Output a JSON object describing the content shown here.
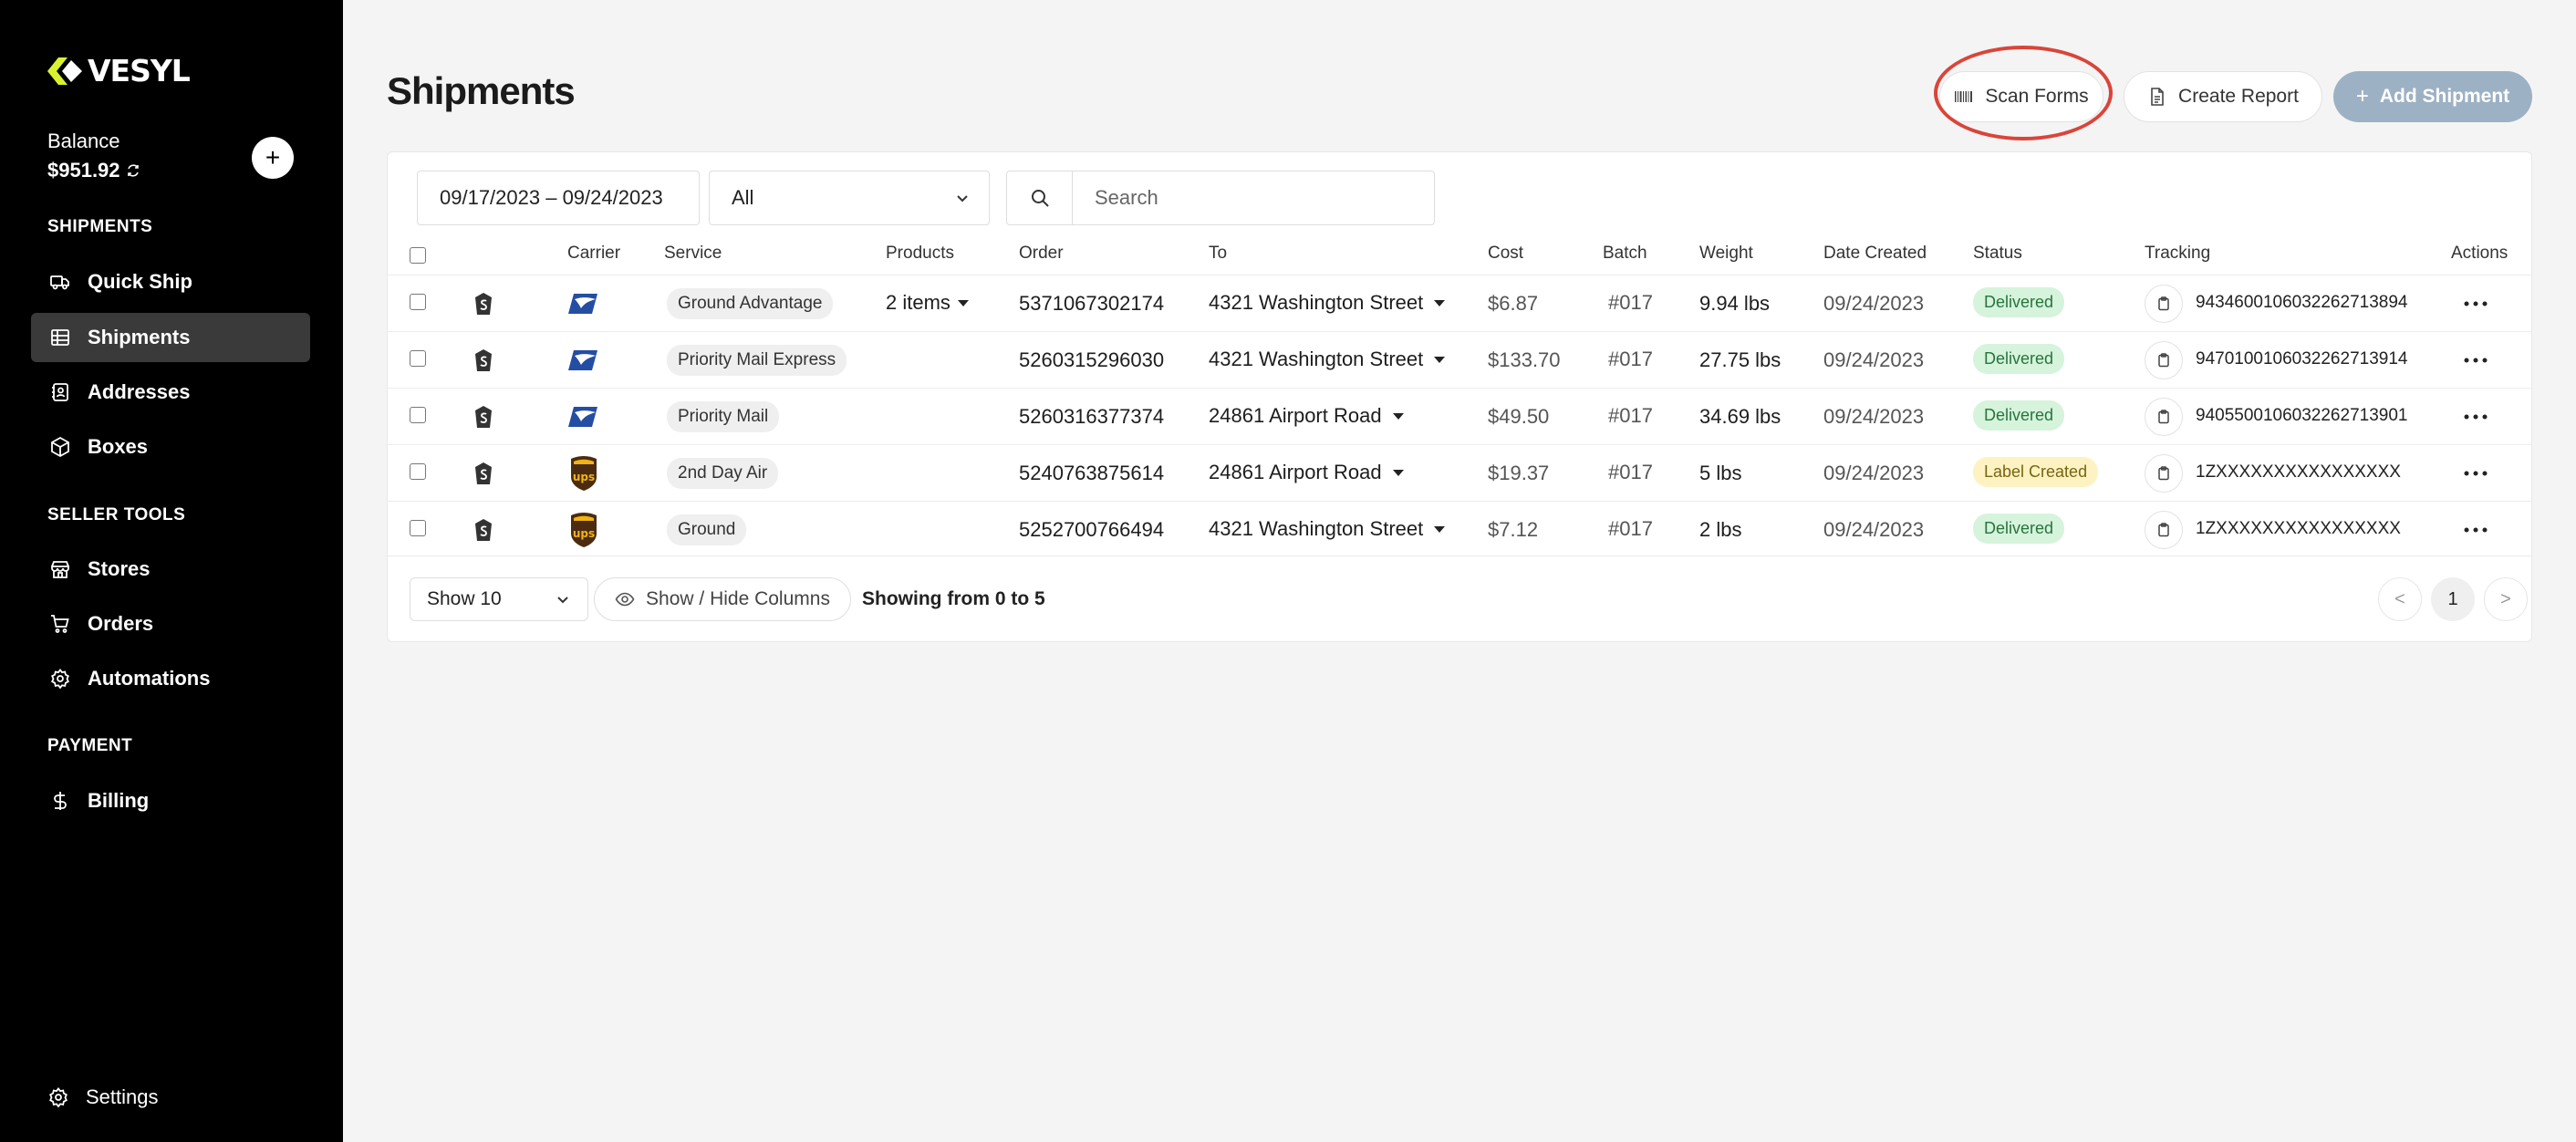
{
  "brand": {
    "name": "VESYL",
    "accent": "#d9f230"
  },
  "balance": {
    "label": "Balance",
    "amount": "$951.92"
  },
  "sidebar": {
    "sections": [
      {
        "title": "SHIPMENTS"
      },
      {
        "title": "SELLER TOOLS"
      },
      {
        "title": "PAYMENT"
      }
    ],
    "items": [
      {
        "label": "Quick Ship",
        "icon": "truck-icon"
      },
      {
        "label": "Shipments",
        "icon": "grid-icon",
        "active": true
      },
      {
        "label": "Addresses",
        "icon": "address-book-icon"
      },
      {
        "label": "Boxes",
        "icon": "box-icon"
      },
      {
        "label": "Stores",
        "icon": "store-icon"
      },
      {
        "label": "Orders",
        "icon": "cart-icon"
      },
      {
        "label": "Automations",
        "icon": "gear-icon"
      },
      {
        "label": "Billing",
        "icon": "dollar-icon"
      }
    ],
    "settings_label": "Settings"
  },
  "header": {
    "title": "Shipments",
    "scan_forms": "Scan Forms",
    "create_report": "Create Report",
    "add_shipment": "Add Shipment"
  },
  "filters": {
    "date_range": "09/17/2023 – 09/24/2023",
    "status": "All",
    "search_placeholder": "Search"
  },
  "table": {
    "columns": [
      "Carrier",
      "Service",
      "Products",
      "Order",
      "To",
      "Cost",
      "Batch",
      "Weight",
      "Date Created",
      "Status",
      "Tracking",
      "Actions"
    ],
    "rows": [
      {
        "carrier": "usps",
        "service": "Ground Advantage",
        "products": "2 items",
        "order": "5371067302174",
        "to": "4321 Washington Street",
        "cost": "$6.87",
        "batch": "#017",
        "weight": "9.94 lbs",
        "date": "09/24/2023",
        "status": "Delivered",
        "tracking": "9434600106032262713894"
      },
      {
        "carrier": "usps",
        "service": "Priority Mail Express",
        "products": "",
        "order": "5260315296030",
        "to": "4321 Washington Street",
        "cost": "$133.70",
        "batch": "#017",
        "weight": "27.75 lbs",
        "date": "09/24/2023",
        "status": "Delivered",
        "tracking": "9470100106032262713914"
      },
      {
        "carrier": "usps",
        "service": "Priority Mail",
        "products": "",
        "order": "5260316377374",
        "to": "24861 Airport Road",
        "cost": "$49.50",
        "batch": "#017",
        "weight": "34.69 lbs",
        "date": "09/24/2023",
        "status": "Delivered",
        "tracking": "9405500106032262713901"
      },
      {
        "carrier": "ups",
        "service": "2nd Day Air",
        "products": "",
        "order": "5240763875614",
        "to": "24861 Airport Road",
        "cost": "$19.37",
        "batch": "#017",
        "weight": "5 lbs",
        "date": "09/24/2023",
        "status": "Label Created",
        "tracking": "1ZXXXXXXXXXXXXXXXX"
      },
      {
        "carrier": "ups",
        "service": "Ground",
        "products": "",
        "order": "5252700766494",
        "to": "4321 Washington Street",
        "cost": "$7.12",
        "batch": "#017",
        "weight": "2 lbs",
        "date": "09/24/2023",
        "status": "Delivered",
        "tracking": "1ZXXXXXXXXXXXXXXXX"
      }
    ]
  },
  "footer": {
    "page_size": "Show 10",
    "columns_toggle": "Show / Hide Columns",
    "showing": "Showing from 0 to 5",
    "prev": "<",
    "current_page": "1",
    "next": ">"
  },
  "colors": {
    "highlight": "#d9453a",
    "add_button": "#9db1c4",
    "delivered_bg": "#d6f3dc",
    "label_created_bg": "#fdf3c2"
  }
}
